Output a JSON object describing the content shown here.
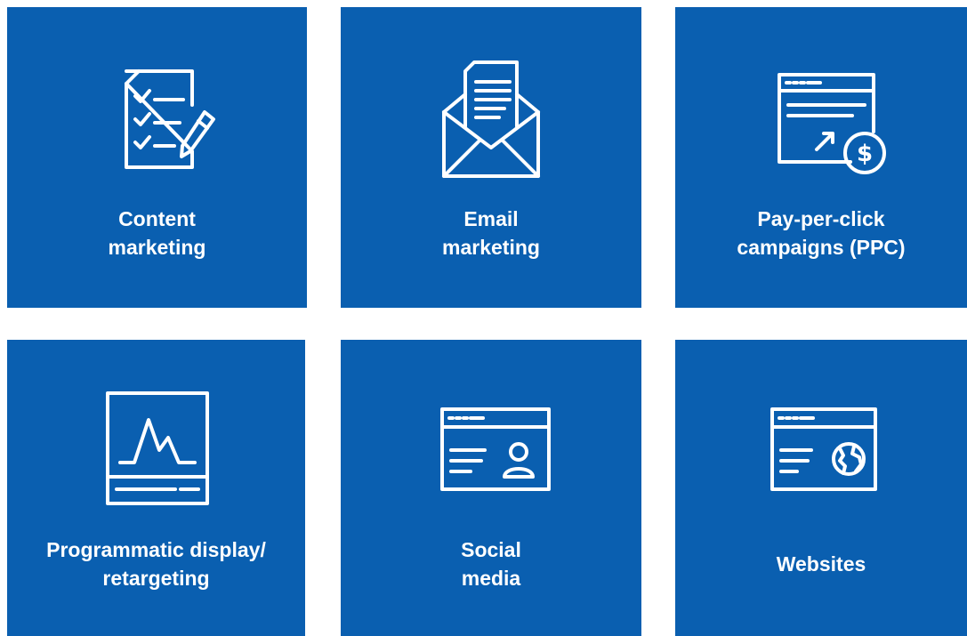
{
  "tiles": [
    {
      "icon": "checklist-pencil-icon",
      "label_lines": [
        "Content",
        "marketing"
      ]
    },
    {
      "icon": "open-envelope-icon",
      "label_lines": [
        "Email",
        "marketing"
      ]
    },
    {
      "icon": "browser-dollar-click-icon",
      "label_lines": [
        "Pay-per-click",
        "campaigns (PPC)"
      ]
    },
    {
      "icon": "monitor-pulse-icon",
      "label_lines": [
        "Programmatic display/",
        "retargeting"
      ]
    },
    {
      "icon": "browser-profile-icon",
      "label_lines": [
        "Social",
        "media"
      ]
    },
    {
      "icon": "browser-globe-icon",
      "label_lines": [
        "Websites"
      ]
    }
  ],
  "colors": {
    "tile_background": "#0a5fb0",
    "foreground": "#ffffff",
    "page_background": "#ffffff"
  }
}
